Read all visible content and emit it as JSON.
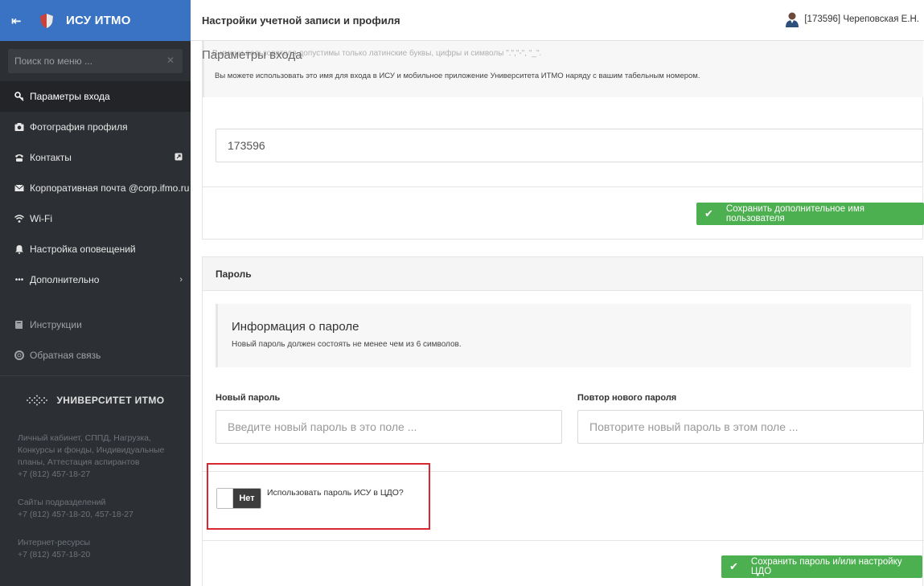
{
  "sidebar": {
    "brand": "ИСУ ИТМО",
    "search_placeholder": "Поиск по меню ...",
    "items": [
      {
        "label": "Параметры входа"
      },
      {
        "label": "Фотография профиля"
      },
      {
        "label": "Контакты"
      },
      {
        "label": "Корпоративная почта @corp.ifmo.ru"
      },
      {
        "label": "Wi-Fi"
      },
      {
        "label": "Настройка оповещений"
      },
      {
        "label": "Дополнительно"
      }
    ],
    "secondary": [
      {
        "label": "Инструкции"
      },
      {
        "label": "Обратная связь"
      }
    ],
    "university": "УНИВЕРСИТЕТ ИТМО",
    "footer": {
      "block1_lines": [
        "Личный кабинет, СППД, Нагрузка,",
        "Конкурсы и фонды, Индивидуальные",
        "планы, Аттестация аспирантов",
        "+7 (812) 457-18-27"
      ],
      "block2_lines": [
        "Сайты подразделений",
        "+7 (812) 457-18-20, 457-18-27"
      ],
      "block3_lines": [
        "Интернет-ресурсы",
        "+7 (812) 457-18-20"
      ]
    }
  },
  "header": {
    "title": "Настройки учетной записи и профиля",
    "user": "[173596] Череповская Е.Н."
  },
  "login": {
    "section_title": "Параметры входа",
    "faded_line1": "В имени пользователя допустимы только латинские буквы, цифры и символы \".\",\"-\", \"_\".",
    "info_line": "Вы можете использовать это имя для входа в ИСУ и мобильное приложение Университета ИТМО наряду с вашим табельным номером.",
    "username_value": "173596",
    "save_button": "Сохранить дополнительное имя пользователя"
  },
  "password": {
    "card_title": "Пароль",
    "info_title": "Информация о пароле",
    "info_text": "Новый пароль должен состоять не менее чем из 6 символов.",
    "new_label": "Новый пароль",
    "new_placeholder": "Введите новый пароль в это поле ...",
    "repeat_label": "Повтор нового пароля",
    "repeat_placeholder": "Повторите новый пароль в этом поле ...",
    "toggle_state": "Нет",
    "toggle_label": "Использовать пароль ИСУ в ЦДО?",
    "save_button": "Сохранить пароль и/или настройку ЦДО"
  },
  "colors": {
    "brand_blue": "#3b73c4",
    "sidebar_bg": "#2c2f33",
    "success_green": "#4caf50",
    "highlight_red": "#d9282f"
  }
}
